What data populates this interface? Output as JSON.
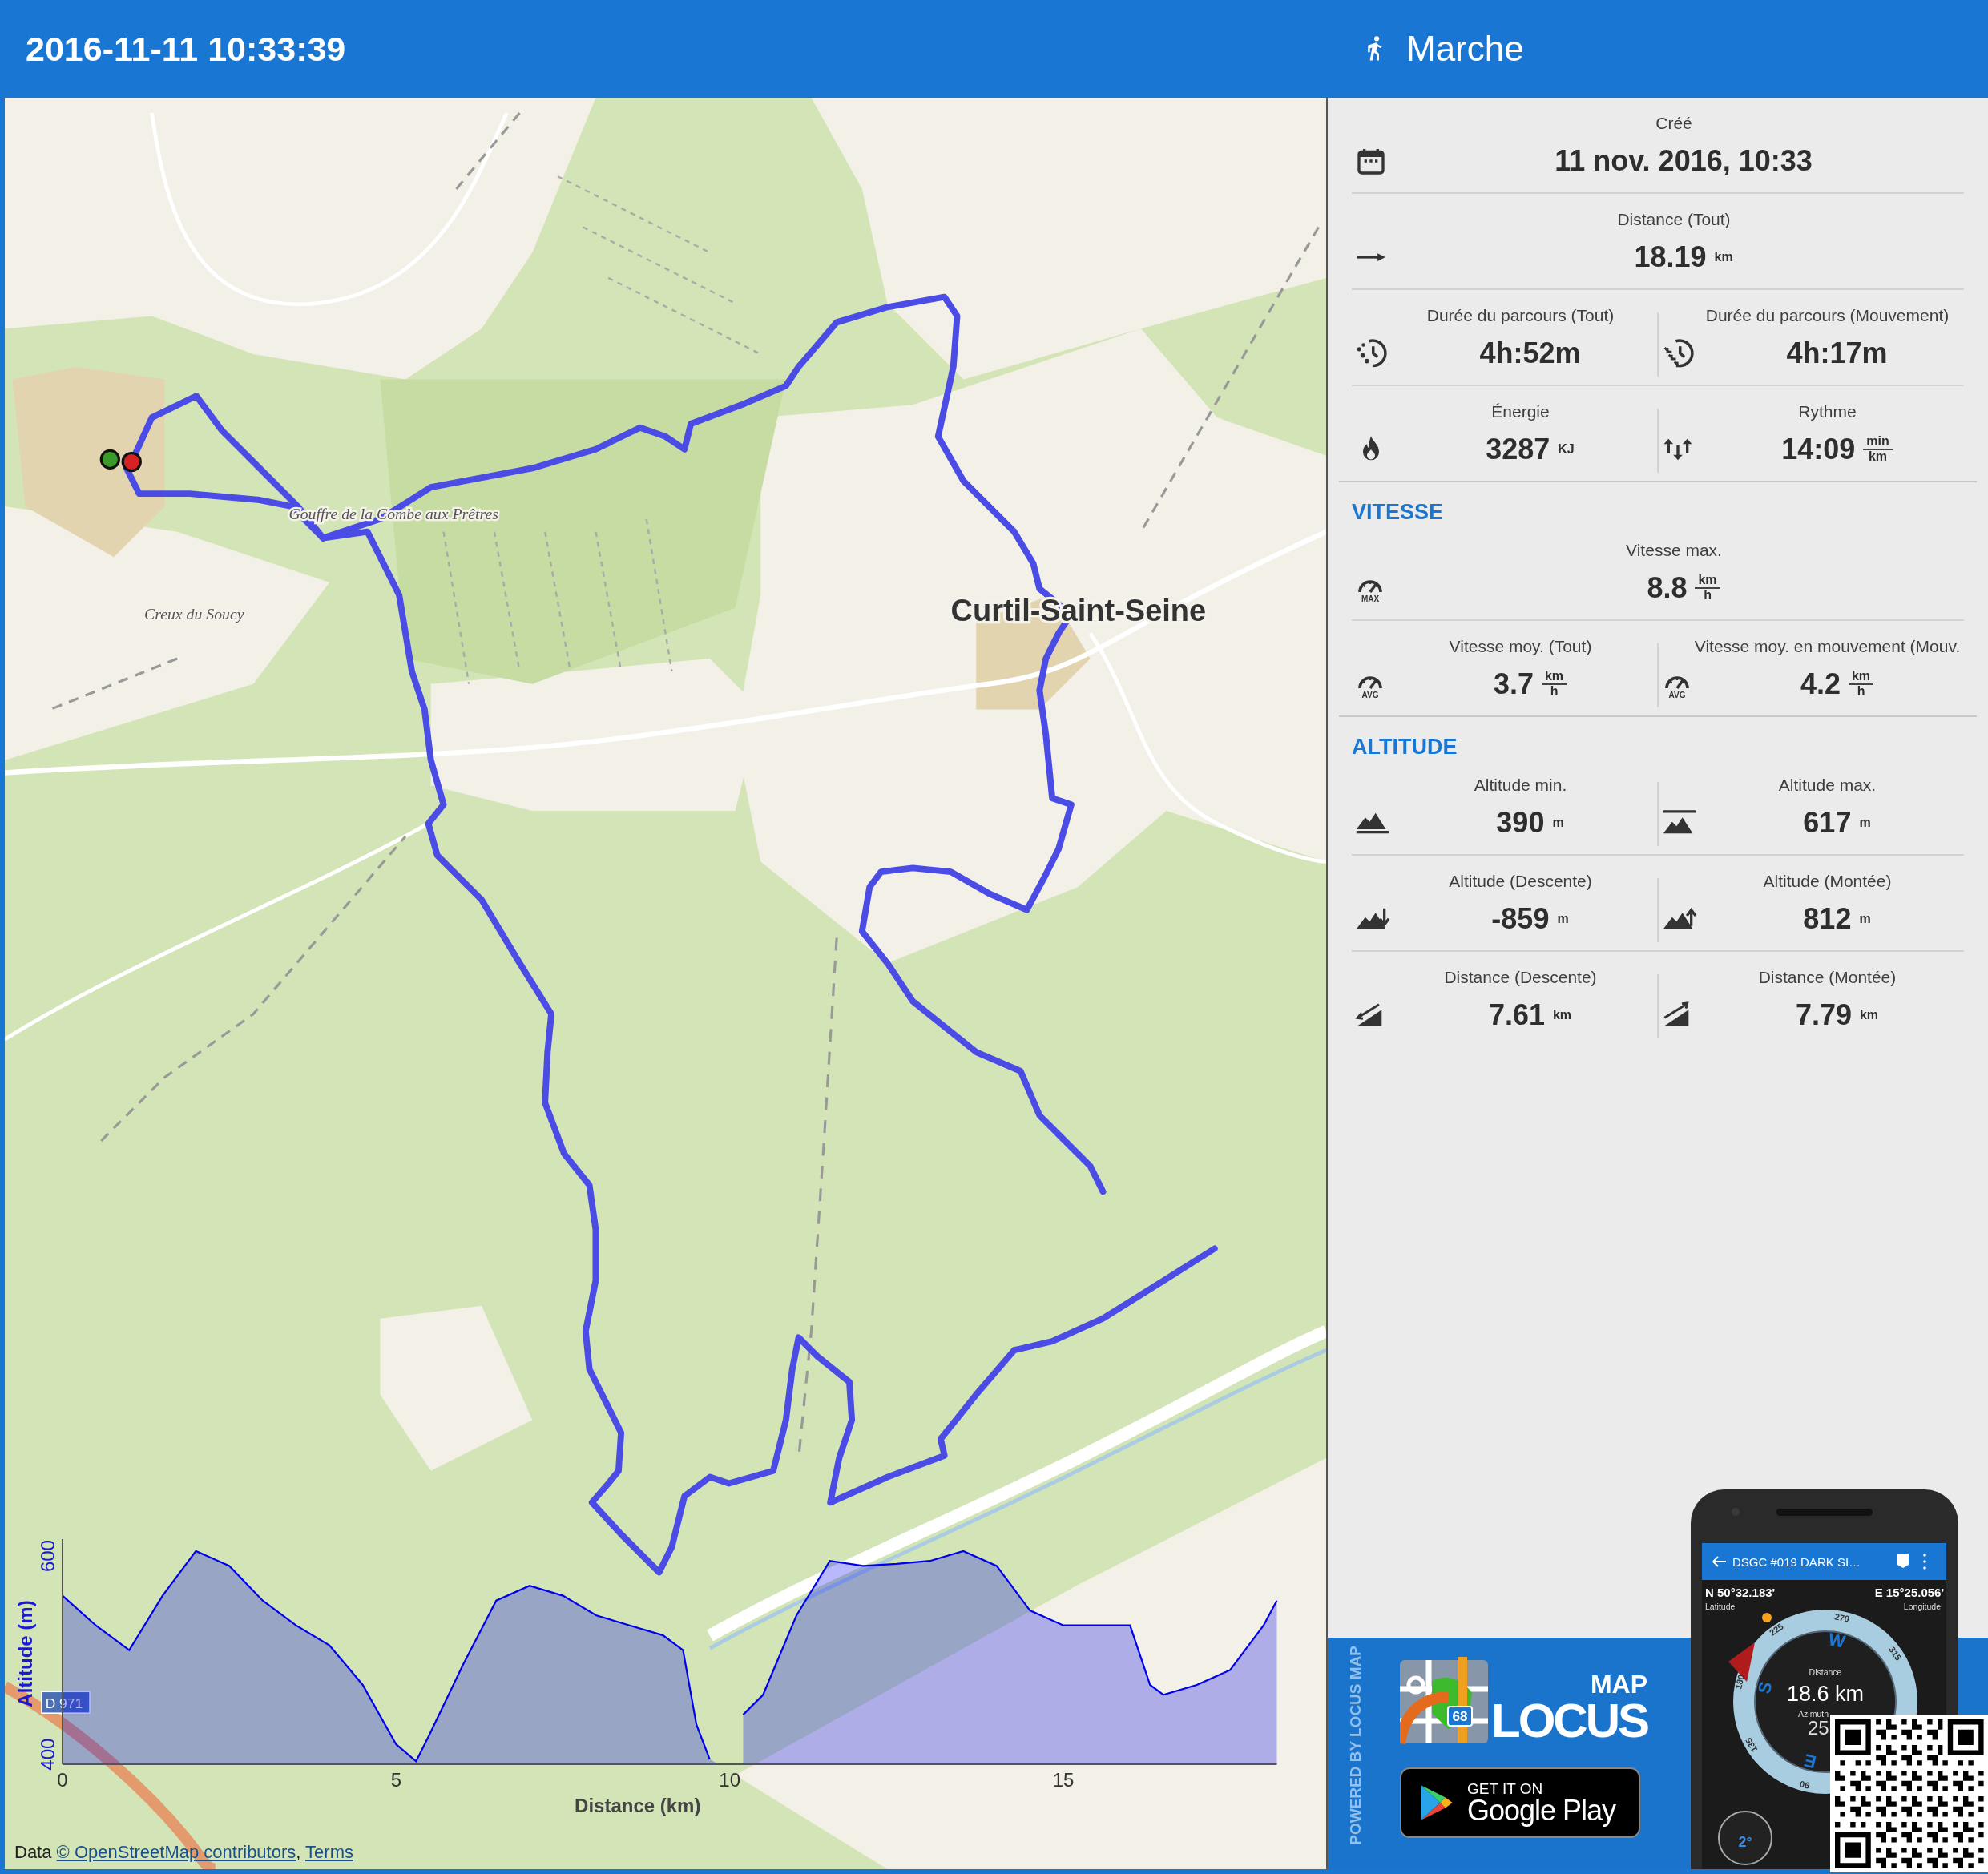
{
  "header": {
    "title": "2016-11-11 10:33:39",
    "activity": "Marche"
  },
  "map": {
    "labels": [
      {
        "kind": "feature",
        "text": "Gouffre de la Combe aux Prêtres"
      },
      {
        "kind": "feature",
        "text": "Creux du Soucy"
      },
      {
        "kind": "place",
        "text": "Curtil-Saint-Seine"
      },
      {
        "kind": "road",
        "text": "D 971"
      }
    ]
  },
  "elevation": {
    "chart_data": {
      "type": "area",
      "xlabel": "Distance (km)",
      "ylabel": "Altitude (m)",
      "xlim": [
        0,
        18.2
      ],
      "ylim": [
        390,
        617
      ],
      "xticks": [
        0,
        5,
        10,
        15
      ],
      "yticks": [
        400,
        600
      ],
      "x": [
        0,
        0.5,
        1,
        1.5,
        2,
        2.5,
        3,
        3.5,
        4,
        4.5,
        5,
        5.3,
        5.5,
        6,
        6.5,
        7,
        7.5,
        8,
        8.5,
        9,
        9.3,
        9.5,
        9.7,
        10,
        10.2,
        10.5,
        11,
        11.5,
        12,
        12.5,
        13,
        13.5,
        14,
        14.5,
        15,
        15.5,
        16,
        16.3,
        16.5,
        17,
        17.5,
        18,
        18.2
      ],
      "series": [
        {
          "color": "#0000ee",
          "values": [
            560,
            530,
            505,
            560,
            605,
            590,
            555,
            530,
            510,
            470,
            410,
            393,
            420,
            490,
            555,
            570,
            560,
            540,
            530,
            520,
            505,
            430,
            395,
            null,
            440,
            460,
            540,
            595,
            590,
            592,
            595,
            605,
            590,
            545,
            530,
            530,
            530,
            470,
            460,
            470,
            485,
            530,
            555
          ]
        }
      ]
    }
  },
  "attribution": {
    "prefix": "Data",
    "link": "© OpenStreetMap contributors",
    "separator": ",",
    "terms": "Terms"
  },
  "stats": {
    "sections": [
      {
        "rows": [
          [
            {
              "label": "Créé",
              "value": "11 nov. 2016, 10:33"
            }
          ],
          [
            {
              "label": "Distance (Tout)",
              "value": "18.19",
              "unit": "km"
            }
          ],
          [
            {
              "label": "Durée du parcours (Tout)",
              "value": "4h:52m"
            },
            {
              "label": "Durée du parcours (Mouvement)",
              "value": "4h:17m"
            }
          ],
          [
            {
              "label": "Énergie",
              "value": "3287",
              "unit": "KJ"
            },
            {
              "label": "Rythme",
              "value": "14:09",
              "unit": "min",
              "unit_per": "km"
            }
          ]
        ]
      },
      {
        "title": "VITESSE",
        "rows": [
          [
            {
              "label": "Vitesse max.",
              "value": "8.8",
              "unit": "km",
              "unit_per": "h",
              "icon_text": "MAX"
            }
          ],
          [
            {
              "label": "Vitesse moy. (Tout)",
              "value": "3.7",
              "unit": "km",
              "unit_per": "h",
              "icon_text": "AVG"
            },
            {
              "label": "Vitesse moy. en mouvement (Mouv.",
              "value": "4.2",
              "unit": "km",
              "unit_per": "h",
              "icon_text": "AVG"
            }
          ]
        ]
      },
      {
        "title": "ALTITUDE",
        "rows": [
          [
            {
              "label": "Altitude min.",
              "value": "390",
              "unit": "m"
            },
            {
              "label": "Altitude max.",
              "value": "617",
              "unit": "m"
            }
          ],
          [
            {
              "label": "Altitude (Descente)",
              "value": "-859",
              "unit": "m"
            },
            {
              "label": "Altitude (Montée)",
              "value": "812",
              "unit": "m"
            }
          ],
          [
            {
              "label": "Distance (Descente)",
              "value": "7.61",
              "unit": "km"
            },
            {
              "label": "Distance (Montée)",
              "value": "7.79",
              "unit": "km"
            }
          ]
        ]
      }
    ]
  },
  "promo": {
    "tagline": "POWERED BY LOCUS MAP",
    "logo_top": "MAP",
    "logo_main": "LOCUS",
    "logo_badge": "68",
    "store_line1": "GET IT ON",
    "store_line2": "Google Play",
    "phone": {
      "title": "DSGC #019 DARK SI…",
      "lat": "N 50°32.183'",
      "lat_label": "Latitude",
      "lon": "E 15°25.056'",
      "lon_label": "Longitude",
      "compass_ticks": [
        "270",
        "225",
        "315",
        "180",
        "135",
        "90"
      ],
      "compass_letters": [
        "W",
        "S",
        "E"
      ],
      "distance_label": "Distance",
      "distance": "18.6 km",
      "azimuth_label": "Azimuth",
      "azimuth": "25",
      "tilt": "2°"
    }
  }
}
